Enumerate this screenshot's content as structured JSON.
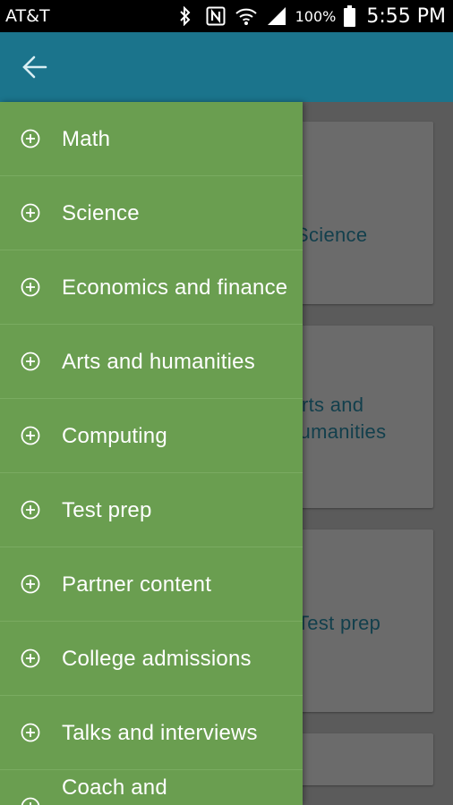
{
  "status_bar": {
    "carrier": "AT&T",
    "battery_percent": "100%",
    "time": "5:55 PM",
    "icons": [
      "bluetooth-icon",
      "nfc-icon",
      "wifi-icon",
      "signal-icon",
      "battery-icon"
    ]
  },
  "app_bar": {
    "back_icon": "back-arrow-icon",
    "color": "#1b748c"
  },
  "drawer": {
    "background": "#6a9e50",
    "items": [
      {
        "label": "Math",
        "icon": "add-circle-icon"
      },
      {
        "label": "Science",
        "icon": "add-circle-icon"
      },
      {
        "label": "Economics and finance",
        "icon": "add-circle-icon"
      },
      {
        "label": "Arts and humanities",
        "icon": "add-circle-icon"
      },
      {
        "label": "Computing",
        "icon": "add-circle-icon"
      },
      {
        "label": "Test prep",
        "icon": "add-circle-icon"
      },
      {
        "label": "Partner content",
        "icon": "add-circle-icon"
      },
      {
        "label": "College admissions",
        "icon": "add-circle-icon"
      },
      {
        "label": "Talks and interviews",
        "icon": "add-circle-icon"
      },
      {
        "label": "Coach and",
        "icon": "add-circle-icon"
      }
    ]
  },
  "background_cards": [
    {
      "label": "Science"
    },
    {
      "label": "Arts and humanities"
    },
    {
      "label": "Test prep"
    }
  ]
}
